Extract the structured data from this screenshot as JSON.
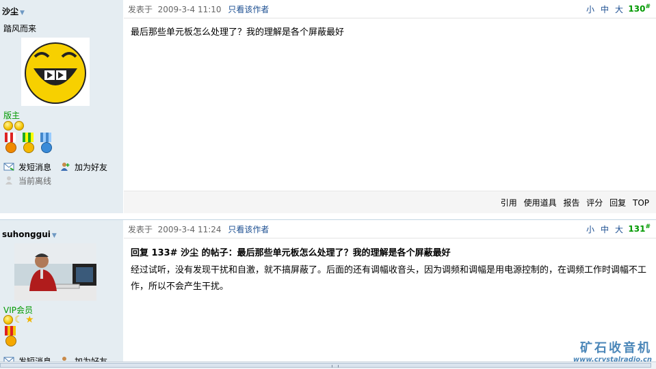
{
  "posts": [
    {
      "author": "沙尘",
      "signature": "踏风而来",
      "group": "版主",
      "posted_prefix": "发表于",
      "posted_time": "2009-3-4 11:10",
      "author_only": "只看该作者",
      "font_small": "小",
      "font_medium": "中",
      "font_large": "大",
      "floor": "130",
      "floor_suffix": "#",
      "content": "最后那些单元板怎么处理了？我的理解是各个屏蔽最好",
      "send_message": "发短消息",
      "add_friend": "加为好友",
      "status": "当前离线",
      "toolbar": [
        "引用",
        "使用道具",
        "报告",
        "评分",
        "回复",
        "TOP"
      ]
    },
    {
      "author": "suhonggui",
      "group": "VIP会员",
      "posted_prefix": "发表于",
      "posted_time": "2009-3-4 11:24",
      "author_only": "只看该作者",
      "font_small": "小",
      "font_medium": "中",
      "font_large": "大",
      "floor": "131",
      "floor_suffix": "#",
      "reply_title": "回复  133# 沙尘  的帖子：最后那些单元板怎么处理了？我的理解是各个屏蔽最好",
      "content": "经过试听，没有发现干扰和自激，就不搞屏蔽了。后面的还有调幅收音头，因为调频和调幅是用电源控制的，在调频工作时调幅不工作，所以不会产生干扰。",
      "send_message": "发短消息",
      "add_friend": "加为好友"
    }
  ],
  "watermark": {
    "title": "矿石收音机",
    "url": "www.crystalradio.cn"
  },
  "colors": {
    "sidebar_bg": "#e5edf2",
    "link": "#1b4e91",
    "group_green": "#009900",
    "floor_green": "#009900"
  }
}
